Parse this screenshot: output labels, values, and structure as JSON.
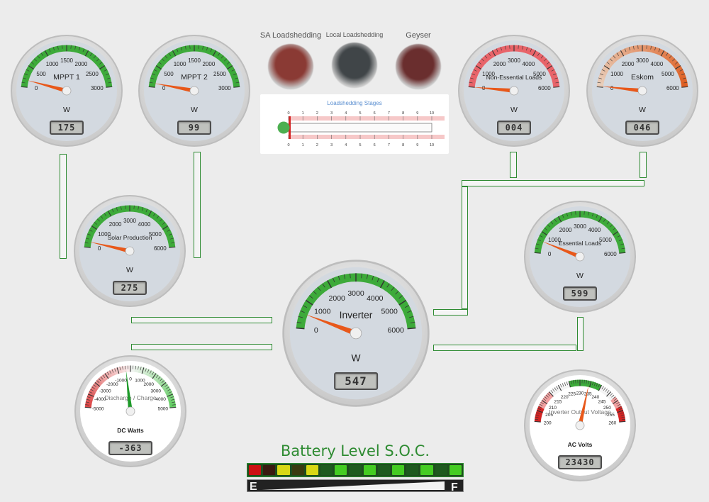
{
  "gauges": [
    {
      "id": "mppt1",
      "title": "MPPT 1",
      "unit": "W",
      "display": "175",
      "value": 175,
      "min": 0,
      "max": 3000,
      "ticks": [
        0,
        500,
        1000,
        1500,
        2000,
        2500,
        3000
      ],
      "scheme": "green-top",
      "needle": "#e8581a"
    },
    {
      "id": "mppt2",
      "title": "MPPT 2",
      "unit": "W",
      "display": "99",
      "value": 99,
      "min": 0,
      "max": 3000,
      "ticks": [
        0,
        500,
        1000,
        1500,
        2000,
        2500,
        3000
      ],
      "scheme": "green-top",
      "needle": "#e8581a"
    },
    {
      "id": "solar",
      "title": "Solar Production",
      "unit": "W",
      "display": "275",
      "value": 275,
      "min": 0,
      "max": 6000,
      "ticks": [
        0,
        1000,
        2000,
        3000,
        4000,
        5000,
        6000
      ],
      "scheme": "green-top",
      "needle": "#e8581a"
    },
    {
      "id": "inverter",
      "title": "Inverter",
      "unit": "W",
      "display": "547",
      "value": 547,
      "min": 0,
      "max": 6000,
      "ticks": [
        0,
        1000,
        2000,
        3000,
        4000,
        5000,
        6000
      ],
      "scheme": "green-top",
      "needle": "#e8581a"
    },
    {
      "id": "nonessential",
      "title": "Non-Essential Loads",
      "unit": "W",
      "display": "004",
      "value": 4,
      "min": 0,
      "max": 6000,
      "ticks": [
        0,
        1000,
        2000,
        3000,
        4000,
        5000,
        6000
      ],
      "scheme": "red-top",
      "needle": "#e8581a"
    },
    {
      "id": "eskom",
      "title": "Eskom",
      "unit": "W",
      "display": "046",
      "value": 46,
      "min": 0,
      "max": 6000,
      "ticks": [
        0,
        1000,
        2000,
        3000,
        4000,
        5000,
        6000
      ],
      "scheme": "orange-top",
      "needle": "#e8581a"
    },
    {
      "id": "essential",
      "title": "Essential Loads",
      "unit": "W",
      "display": "599",
      "value": 599,
      "min": 0,
      "max": 6000,
      "ticks": [
        0,
        1000,
        2000,
        3000,
        4000,
        5000,
        6000
      ],
      "scheme": "green-top",
      "needle": "#e8581a"
    },
    {
      "id": "dcwatts",
      "title": "Discharge / Charge",
      "unit": "DC Watts",
      "display": "-363",
      "value": -363,
      "min": -5000,
      "max": 5000,
      "ticks": [
        -5000,
        -4000,
        -3000,
        -2000,
        -1000,
        0,
        1000,
        2000,
        3000,
        4000,
        5000
      ],
      "scheme": "red-green",
      "needle": "#1e9a2a"
    },
    {
      "id": "acvolts",
      "title": "Inverter Output Voltage",
      "unit": "AC Volts",
      "display": "23430",
      "value": 234.3,
      "min": 200,
      "max": 260,
      "ticks": [
        200,
        205,
        210,
        215,
        220,
        225,
        230,
        235,
        240,
        245,
        250,
        255,
        260
      ],
      "scheme": "volt",
      "needle": "#e8581a"
    }
  ],
  "lamps": [
    {
      "label": "SA Loadshedding",
      "color": "#8a3a34"
    },
    {
      "label": "Local Loadshedding",
      "color": "#404548"
    },
    {
      "label": "Geyser",
      "color": "#6a2e2e"
    }
  ],
  "loadshedding": {
    "title": "Loadshedding Stages",
    "ticks": [
      "0",
      "1",
      "2",
      "3",
      "4",
      "5",
      "6",
      "7",
      "8",
      "9",
      "10"
    ],
    "value": 0
  },
  "battery": {
    "title": "Battery Level S.O.C.",
    "segments": [
      "#cc1111",
      "#3a1a10",
      "#d8d815",
      "#3a3a10",
      "#d8d815",
      "#1e5a1e",
      "#44cc22",
      "#1e5a1e",
      "#44cc22",
      "#1e5a1e",
      "#44cc22",
      "#1e5a1e",
      "#44cc22",
      "#1e5a1e",
      "#44cc22"
    ],
    "empty_label": "E",
    "full_label": "F"
  }
}
